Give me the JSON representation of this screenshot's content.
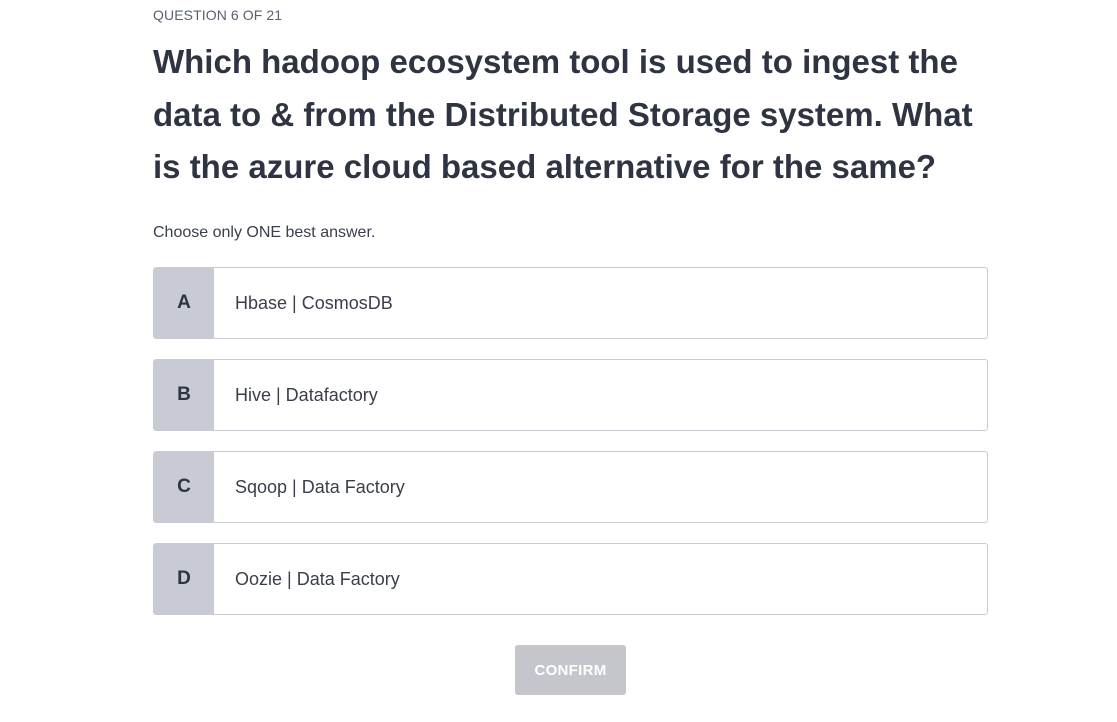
{
  "quiz": {
    "counter": "QUESTION 6 OF 21",
    "question": "Which hadoop ecosystem tool is used to ingest the data to & from the Distributed Storage system. What is the azure cloud based alternative for the same?",
    "instruction": "Choose only ONE best answer.",
    "options": [
      {
        "letter": "A",
        "text": "Hbase | CosmosDB"
      },
      {
        "letter": "B",
        "text": "Hive | Datafactory"
      },
      {
        "letter": "C",
        "text": "Sqoop | Data Factory"
      },
      {
        "letter": "D",
        "text": "Oozie | Data Factory"
      }
    ],
    "confirm_label": "CONFIRM",
    "confirm_enabled": false
  },
  "colors": {
    "text_primary": "#2f3442",
    "letter_tile": "#c8cbd3",
    "option_border": "#c9ccd3",
    "confirm_disabled_bg": "#c4c6cc",
    "confirm_text": "#ffffff"
  }
}
